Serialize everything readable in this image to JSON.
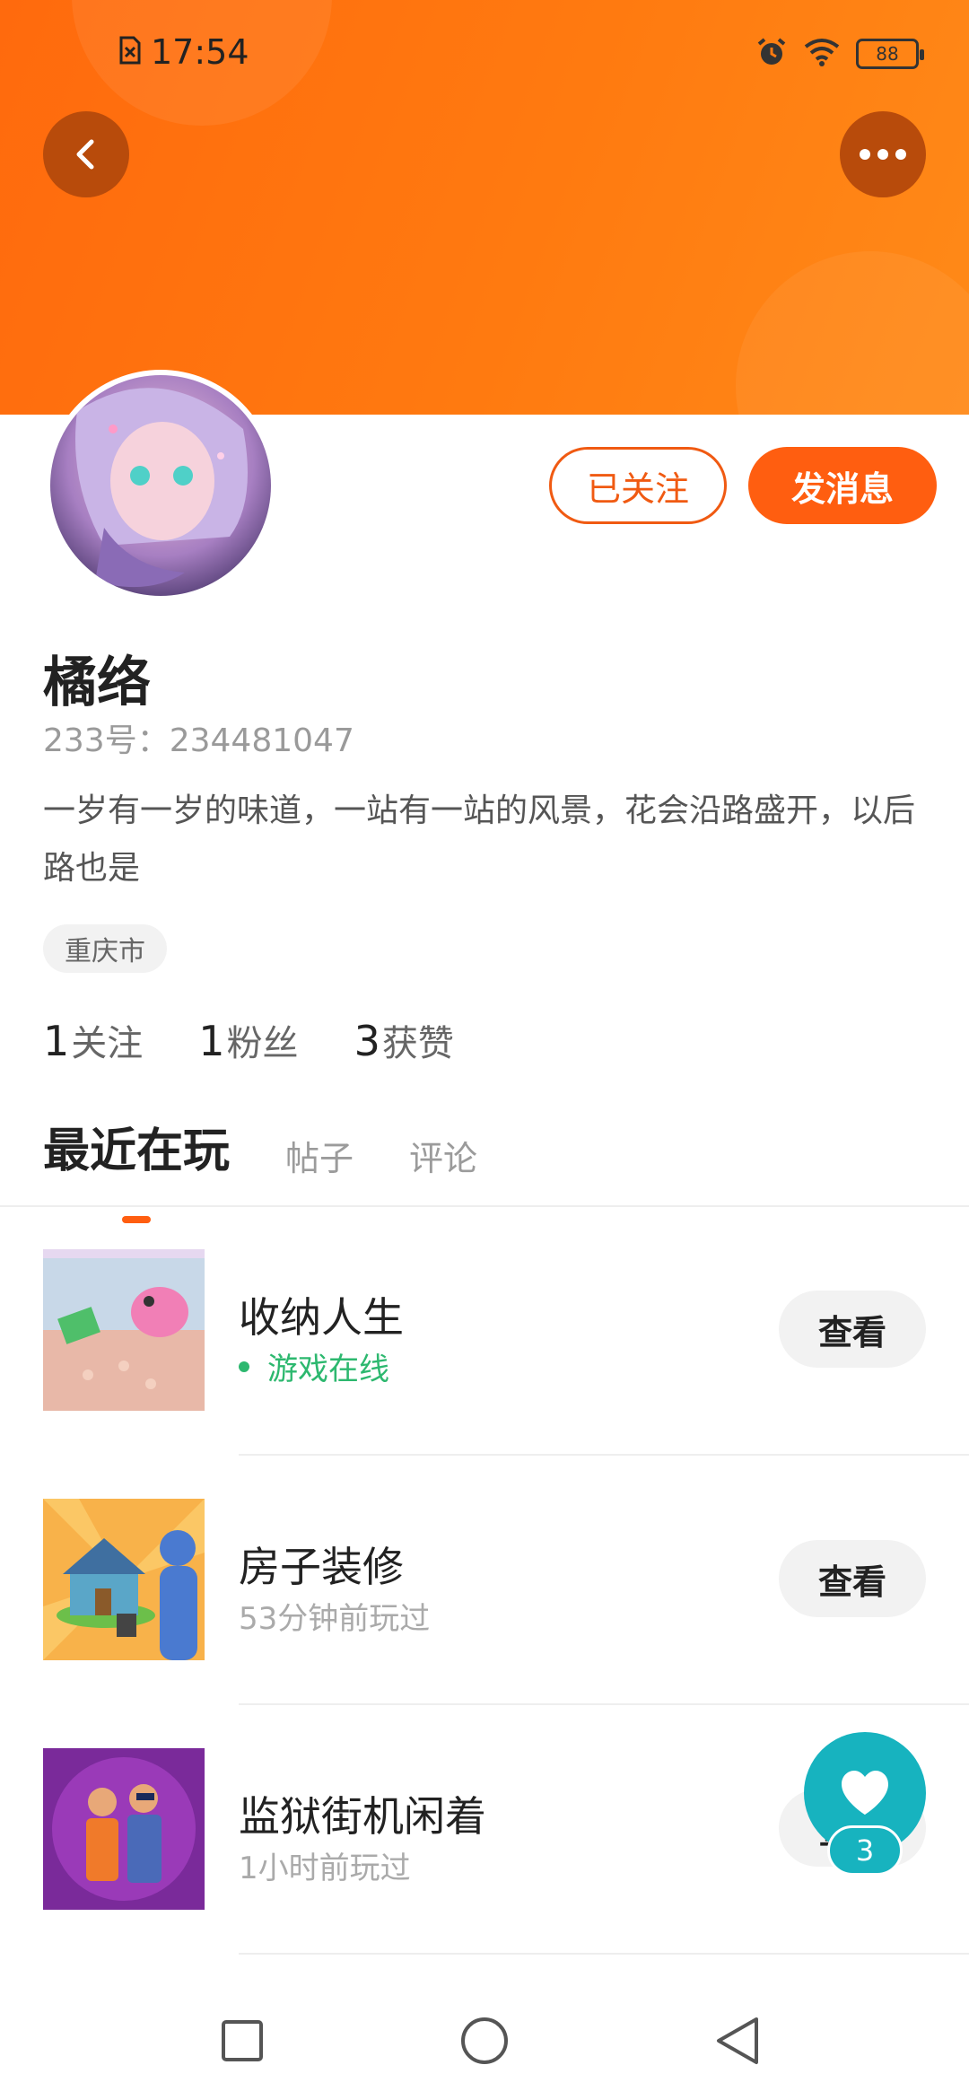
{
  "status_bar": {
    "time": "17:54",
    "battery": "88",
    "icons": [
      "sim-error-icon",
      "alarm-icon",
      "wifi-icon",
      "battery-icon"
    ]
  },
  "header": {
    "back_icon": "chevron-left-icon",
    "more_icon": "more-dots-icon",
    "accent_color": "#ff6a0d"
  },
  "profile": {
    "name": "橘络",
    "uid": "233号：234481047",
    "bio": "一岁有一岁的味道，一站有一站的风景，花会沿路盛开，以后路也是",
    "location": "重庆市",
    "followed_label": "已关注",
    "message_label": "发消息",
    "stats": [
      {
        "num": "1",
        "label": "关注"
      },
      {
        "num": "1",
        "label": "粉丝"
      },
      {
        "num": "3",
        "label": "获赞"
      }
    ]
  },
  "tabs": [
    {
      "label": "最近在玩",
      "active": true
    },
    {
      "label": "帖子",
      "active": false
    },
    {
      "label": "评论",
      "active": false
    }
  ],
  "games": [
    {
      "name": "收纳人生",
      "status": "游戏在线",
      "online": true,
      "action": "查看"
    },
    {
      "name": "房子装修",
      "status": "53分钟前玩过",
      "online": false,
      "action": "查看"
    },
    {
      "name": "监狱街机闲着",
      "status": "1小时前玩过",
      "online": false,
      "action": "查看"
    }
  ],
  "like_fab": {
    "count": "3",
    "icon": "heart-icon",
    "color": "#17b3bf"
  },
  "nav": {
    "icons": [
      "recent-apps-icon",
      "home-icon",
      "back-icon"
    ]
  }
}
